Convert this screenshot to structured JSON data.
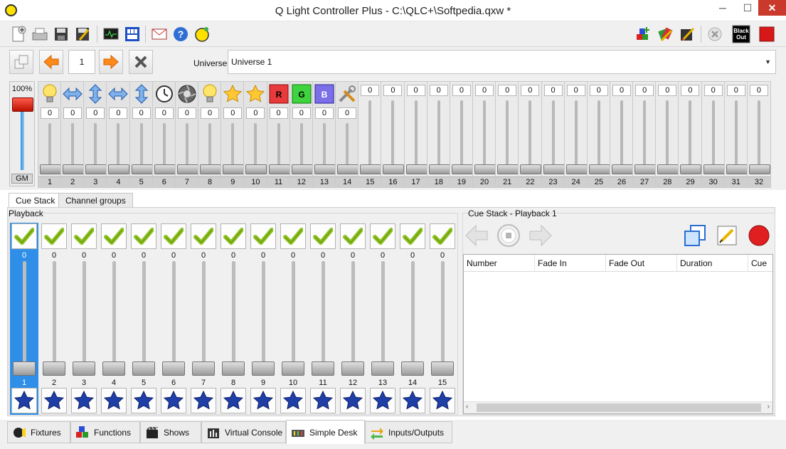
{
  "window": {
    "title": "Q Light Controller Plus - C:\\QLC+\\Softpedia.qxw *",
    "minimize": "─",
    "maximize": "☐",
    "close": "✕"
  },
  "toolbar": {
    "icons": [
      "new-workspace",
      "open",
      "save",
      "save-as",
      "monitor",
      "address-tool",
      "email",
      "help",
      "about",
      "fixture-editor",
      "palette",
      "edit-mode",
      "stop-all",
      "blackout",
      "live-mode"
    ],
    "blackout_text": [
      "Black",
      "Out"
    ]
  },
  "desk": {
    "page": "1",
    "universe_label": "Universe",
    "universe_value": "Universe 1",
    "grand_master_percent": "100%",
    "grand_master_label": "GM"
  },
  "channels": [
    {
      "num": "1",
      "value": "0",
      "icon": "bulb-icon",
      "patched": true
    },
    {
      "num": "2",
      "value": "0",
      "icon": "pan-icon",
      "patched": true
    },
    {
      "num": "3",
      "value": "0",
      "icon": "tilt-icon",
      "patched": true
    },
    {
      "num": "4",
      "value": "0",
      "icon": "pan-icon",
      "patched": true
    },
    {
      "num": "5",
      "value": "0",
      "icon": "tilt-icon",
      "patched": true
    },
    {
      "num": "6",
      "value": "0",
      "icon": "speed-icon",
      "patched": true
    },
    {
      "num": "7",
      "value": "0",
      "icon": "shutter-icon",
      "patched": true
    },
    {
      "num": "8",
      "value": "0",
      "icon": "bulb-icon",
      "patched": true
    },
    {
      "num": "9",
      "value": "0",
      "icon": "star-icon",
      "patched": true
    },
    {
      "num": "10",
      "value": "0",
      "icon": "star-icon",
      "patched": true
    },
    {
      "num": "11",
      "value": "0",
      "icon": "red-icon",
      "patched": true
    },
    {
      "num": "12",
      "value": "0",
      "icon": "green-icon",
      "patched": true
    },
    {
      "num": "13",
      "value": "0",
      "icon": "blue-icon",
      "patched": true
    },
    {
      "num": "14",
      "value": "0",
      "icon": "tools-icon",
      "patched": true
    },
    {
      "num": "15",
      "value": "0",
      "icon": "",
      "patched": false
    },
    {
      "num": "16",
      "value": "0",
      "icon": "",
      "patched": false
    },
    {
      "num": "17",
      "value": "0",
      "icon": "",
      "patched": false
    },
    {
      "num": "18",
      "value": "0",
      "icon": "",
      "patched": false
    },
    {
      "num": "19",
      "value": "0",
      "icon": "",
      "patched": false
    },
    {
      "num": "20",
      "value": "0",
      "icon": "",
      "patched": false
    },
    {
      "num": "21",
      "value": "0",
      "icon": "",
      "patched": false
    },
    {
      "num": "22",
      "value": "0",
      "icon": "",
      "patched": false
    },
    {
      "num": "23",
      "value": "0",
      "icon": "",
      "patched": false
    },
    {
      "num": "24",
      "value": "0",
      "icon": "",
      "patched": false
    },
    {
      "num": "25",
      "value": "0",
      "icon": "",
      "patched": false
    },
    {
      "num": "26",
      "value": "0",
      "icon": "",
      "patched": false
    },
    {
      "num": "27",
      "value": "0",
      "icon": "",
      "patched": false
    },
    {
      "num": "28",
      "value": "0",
      "icon": "",
      "patched": false
    },
    {
      "num": "29",
      "value": "0",
      "icon": "",
      "patched": false
    },
    {
      "num": "30",
      "value": "0",
      "icon": "",
      "patched": false
    },
    {
      "num": "31",
      "value": "0",
      "icon": "",
      "patched": false
    },
    {
      "num": "32",
      "value": "0",
      "icon": "",
      "patched": false
    }
  ],
  "panel_tabs": [
    "Cue Stack",
    "Channel groups"
  ],
  "playback": {
    "label": "Playback",
    "items": [
      {
        "num": "1",
        "value": "0",
        "selected": true
      },
      {
        "num": "2",
        "value": "0",
        "selected": false
      },
      {
        "num": "3",
        "value": "0",
        "selected": false
      },
      {
        "num": "4",
        "value": "0",
        "selected": false
      },
      {
        "num": "5",
        "value": "0",
        "selected": false
      },
      {
        "num": "6",
        "value": "0",
        "selected": false
      },
      {
        "num": "7",
        "value": "0",
        "selected": false
      },
      {
        "num": "8",
        "value": "0",
        "selected": false
      },
      {
        "num": "9",
        "value": "0",
        "selected": false
      },
      {
        "num": "10",
        "value": "0",
        "selected": false
      },
      {
        "num": "11",
        "value": "0",
        "selected": false
      },
      {
        "num": "12",
        "value": "0",
        "selected": false
      },
      {
        "num": "13",
        "value": "0",
        "selected": false
      },
      {
        "num": "14",
        "value": "0",
        "selected": false
      },
      {
        "num": "15",
        "value": "0",
        "selected": false
      }
    ]
  },
  "cue_stack": {
    "label": "Cue Stack - Playback 1",
    "columns": [
      "Number",
      "Fade In",
      "Fade Out",
      "Duration",
      "Cue"
    ]
  },
  "bottom_tabs": [
    {
      "label": "Fixtures",
      "icon": "fixtures-icon",
      "active": false
    },
    {
      "label": "Functions",
      "icon": "functions-icon",
      "active": false
    },
    {
      "label": "Shows",
      "icon": "shows-icon",
      "active": false
    },
    {
      "label": "Virtual Console",
      "icon": "virtual-console-icon",
      "active": false
    },
    {
      "label": "Simple Desk",
      "icon": "simple-desk-icon",
      "active": true
    },
    {
      "label": "Inputs/Outputs",
      "icon": "inputs-outputs-icon",
      "active": false
    }
  ],
  "colors": {
    "accent": "#2f8fe8",
    "fader_red": "#d42a1a",
    "check_green": "#8dc21f",
    "star_blue": "#1f3fa7"
  }
}
